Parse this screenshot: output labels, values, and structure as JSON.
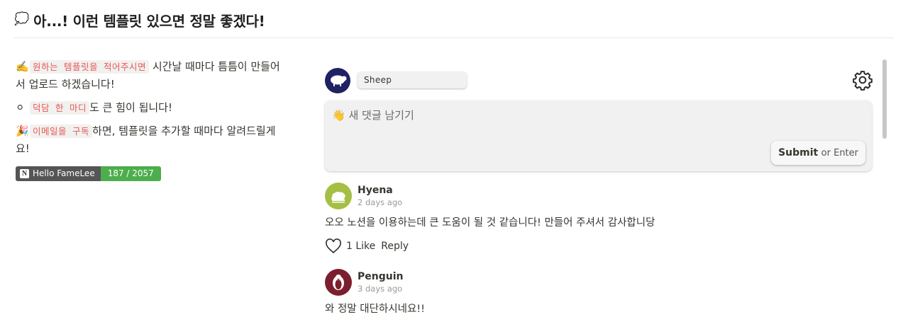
{
  "header": {
    "emoji": "💭",
    "title": "아...! 이런 템플릿 있으면 정말 좋겠다!"
  },
  "left": {
    "line1": {
      "emoji": "✍️",
      "code": "원하는 템플릿을 적어주시면",
      "text": " 시간날 때마다 틈틈이 만들어서 업로드 하겠습니다!"
    },
    "line2": {
      "emoji": "⚪",
      "code": "덕담 한 마디",
      "text": "도 큰 힘이 됩니다!"
    },
    "line3": {
      "emoji": "🎉",
      "code": "이메일을 구독",
      "text": "하면, 템플릿을 추가할 때마다 알려드릴게요!"
    },
    "badge": {
      "label": "Hello FameLee",
      "count": "187 / 2057"
    }
  },
  "composer": {
    "user_name": "Sheep",
    "placeholder": "👋 새 댓글 남기기",
    "submit_label": "Submit",
    "submit_hint": "or Enter"
  },
  "comments": [
    {
      "name": "Hyena",
      "time": "2 days ago",
      "text": "오오 노션을 이용하는데 큰 도움이 될 것 같습니다! 만들어 주셔서 감사합니당",
      "likes": "1 Like",
      "reply": "Reply"
    },
    {
      "name": "Penguin",
      "time": "3 days ago",
      "text": "와 정말 대단하시네요!!"
    }
  ],
  "colors": {
    "code_text": "#eb5757",
    "badge_left": "#555555",
    "badge_right": "#4cae4c",
    "sheep_avatar": "#1f2163",
    "hyena_avatar": "#a4bf43",
    "penguin_avatar": "#7b1f2e"
  }
}
